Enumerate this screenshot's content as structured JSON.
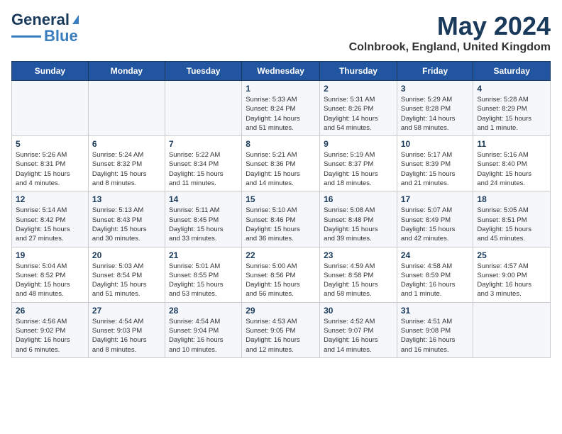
{
  "logo": {
    "line1": "General",
    "line2": "Blue"
  },
  "header": {
    "month": "May 2024",
    "location": "Colnbrook, England, United Kingdom"
  },
  "weekdays": [
    "Sunday",
    "Monday",
    "Tuesday",
    "Wednesday",
    "Thursday",
    "Friday",
    "Saturday"
  ],
  "weeks": [
    [
      {
        "day": "",
        "info": ""
      },
      {
        "day": "",
        "info": ""
      },
      {
        "day": "",
        "info": ""
      },
      {
        "day": "1",
        "info": "Sunrise: 5:33 AM\nSunset: 8:24 PM\nDaylight: 14 hours\nand 51 minutes."
      },
      {
        "day": "2",
        "info": "Sunrise: 5:31 AM\nSunset: 8:26 PM\nDaylight: 14 hours\nand 54 minutes."
      },
      {
        "day": "3",
        "info": "Sunrise: 5:29 AM\nSunset: 8:28 PM\nDaylight: 14 hours\nand 58 minutes."
      },
      {
        "day": "4",
        "info": "Sunrise: 5:28 AM\nSunset: 8:29 PM\nDaylight: 15 hours\nand 1 minute."
      }
    ],
    [
      {
        "day": "5",
        "info": "Sunrise: 5:26 AM\nSunset: 8:31 PM\nDaylight: 15 hours\nand 4 minutes."
      },
      {
        "day": "6",
        "info": "Sunrise: 5:24 AM\nSunset: 8:32 PM\nDaylight: 15 hours\nand 8 minutes."
      },
      {
        "day": "7",
        "info": "Sunrise: 5:22 AM\nSunset: 8:34 PM\nDaylight: 15 hours\nand 11 minutes."
      },
      {
        "day": "8",
        "info": "Sunrise: 5:21 AM\nSunset: 8:36 PM\nDaylight: 15 hours\nand 14 minutes."
      },
      {
        "day": "9",
        "info": "Sunrise: 5:19 AM\nSunset: 8:37 PM\nDaylight: 15 hours\nand 18 minutes."
      },
      {
        "day": "10",
        "info": "Sunrise: 5:17 AM\nSunset: 8:39 PM\nDaylight: 15 hours\nand 21 minutes."
      },
      {
        "day": "11",
        "info": "Sunrise: 5:16 AM\nSunset: 8:40 PM\nDaylight: 15 hours\nand 24 minutes."
      }
    ],
    [
      {
        "day": "12",
        "info": "Sunrise: 5:14 AM\nSunset: 8:42 PM\nDaylight: 15 hours\nand 27 minutes."
      },
      {
        "day": "13",
        "info": "Sunrise: 5:13 AM\nSunset: 8:43 PM\nDaylight: 15 hours\nand 30 minutes."
      },
      {
        "day": "14",
        "info": "Sunrise: 5:11 AM\nSunset: 8:45 PM\nDaylight: 15 hours\nand 33 minutes."
      },
      {
        "day": "15",
        "info": "Sunrise: 5:10 AM\nSunset: 8:46 PM\nDaylight: 15 hours\nand 36 minutes."
      },
      {
        "day": "16",
        "info": "Sunrise: 5:08 AM\nSunset: 8:48 PM\nDaylight: 15 hours\nand 39 minutes."
      },
      {
        "day": "17",
        "info": "Sunrise: 5:07 AM\nSunset: 8:49 PM\nDaylight: 15 hours\nand 42 minutes."
      },
      {
        "day": "18",
        "info": "Sunrise: 5:05 AM\nSunset: 8:51 PM\nDaylight: 15 hours\nand 45 minutes."
      }
    ],
    [
      {
        "day": "19",
        "info": "Sunrise: 5:04 AM\nSunset: 8:52 PM\nDaylight: 15 hours\nand 48 minutes."
      },
      {
        "day": "20",
        "info": "Sunrise: 5:03 AM\nSunset: 8:54 PM\nDaylight: 15 hours\nand 51 minutes."
      },
      {
        "day": "21",
        "info": "Sunrise: 5:01 AM\nSunset: 8:55 PM\nDaylight: 15 hours\nand 53 minutes."
      },
      {
        "day": "22",
        "info": "Sunrise: 5:00 AM\nSunset: 8:56 PM\nDaylight: 15 hours\nand 56 minutes."
      },
      {
        "day": "23",
        "info": "Sunrise: 4:59 AM\nSunset: 8:58 PM\nDaylight: 15 hours\nand 58 minutes."
      },
      {
        "day": "24",
        "info": "Sunrise: 4:58 AM\nSunset: 8:59 PM\nDaylight: 16 hours\nand 1 minute."
      },
      {
        "day": "25",
        "info": "Sunrise: 4:57 AM\nSunset: 9:00 PM\nDaylight: 16 hours\nand 3 minutes."
      }
    ],
    [
      {
        "day": "26",
        "info": "Sunrise: 4:56 AM\nSunset: 9:02 PM\nDaylight: 16 hours\nand 6 minutes."
      },
      {
        "day": "27",
        "info": "Sunrise: 4:54 AM\nSunset: 9:03 PM\nDaylight: 16 hours\nand 8 minutes."
      },
      {
        "day": "28",
        "info": "Sunrise: 4:54 AM\nSunset: 9:04 PM\nDaylight: 16 hours\nand 10 minutes."
      },
      {
        "day": "29",
        "info": "Sunrise: 4:53 AM\nSunset: 9:05 PM\nDaylight: 16 hours\nand 12 minutes."
      },
      {
        "day": "30",
        "info": "Sunrise: 4:52 AM\nSunset: 9:07 PM\nDaylight: 16 hours\nand 14 minutes."
      },
      {
        "day": "31",
        "info": "Sunrise: 4:51 AM\nSunset: 9:08 PM\nDaylight: 16 hours\nand 16 minutes."
      },
      {
        "day": "",
        "info": ""
      }
    ]
  ]
}
